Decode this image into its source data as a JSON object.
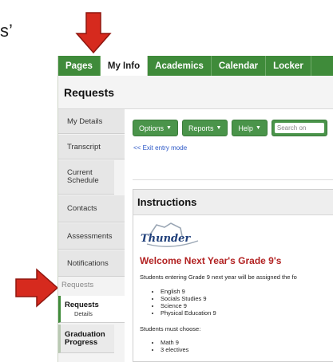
{
  "fragment_text": "s’",
  "colors": {
    "nav_green": "#3f8b3a",
    "button_green": "#4a944a",
    "arrow_red": "#d62a1e",
    "welcome_red": "#b22222",
    "link_blue": "#2a56c6"
  },
  "topnav": {
    "tabs": [
      {
        "label": "Pages",
        "active": false
      },
      {
        "label": "My Info",
        "active": true
      },
      {
        "label": "Academics",
        "active": false
      },
      {
        "label": "Calendar",
        "active": false
      },
      {
        "label": "Locker",
        "active": false
      }
    ]
  },
  "header": {
    "title": "Requests"
  },
  "sidebar": {
    "items": [
      {
        "label": "My Details"
      },
      {
        "label": "Transcript"
      },
      {
        "label": "Current Schedule"
      },
      {
        "label": "Contacts"
      },
      {
        "label": "Assessments"
      },
      {
        "label": "Notifications"
      }
    ],
    "group_label": "Requests",
    "active_item": {
      "label": "Requests",
      "sub": "Details"
    },
    "last_item": {
      "label": "Graduation Progress"
    }
  },
  "toolbar": {
    "options_label": "Options",
    "reports_label": "Reports",
    "help_label": "Help",
    "search_placeholder": "Search on"
  },
  "exit_link": "<< Exit entry mode",
  "instructions": {
    "heading": "Instructions",
    "logo_text": "Thunder",
    "welcome": "Welcome Next Year's Grade 9's",
    "intro": "Students entering Grade 9 next year will be assigned the fo",
    "assigned": [
      "English 9",
      "Socials Studies 9",
      "Science 9",
      "Physical Education 9"
    ],
    "must_choose": "Students must choose:",
    "choose": [
      "Math 9",
      "3 electives"
    ]
  }
}
